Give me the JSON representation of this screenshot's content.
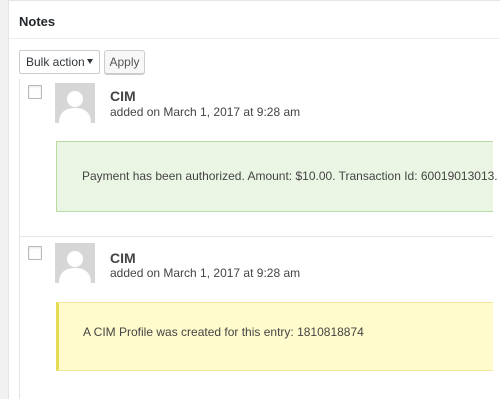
{
  "panel": {
    "title": "Notes"
  },
  "toolbar": {
    "bulk_action_selected": "Bulk action",
    "apply_label": "Apply"
  },
  "notes": [
    {
      "author": "CIM",
      "date_text": "added on March 1, 2017 at 9:28 am",
      "message": "Payment has been authorized. Amount: $10.00. Transaction Id: 60019013013.",
      "type": "success"
    },
    {
      "author": "CIM",
      "date_text": "added on March 1, 2017 at 9:28 am",
      "message": "A CIM Profile was created for this entry: 1810818874",
      "type": "info"
    }
  ],
  "colors": {
    "success_bg": "#ebf5e4",
    "success_border": "#b7dba0",
    "info_bg": "#fffbcc",
    "info_accent": "#e6db55"
  },
  "icons": {
    "avatar": "default-avatar-icon",
    "select_caret": "caret-down-icon"
  }
}
